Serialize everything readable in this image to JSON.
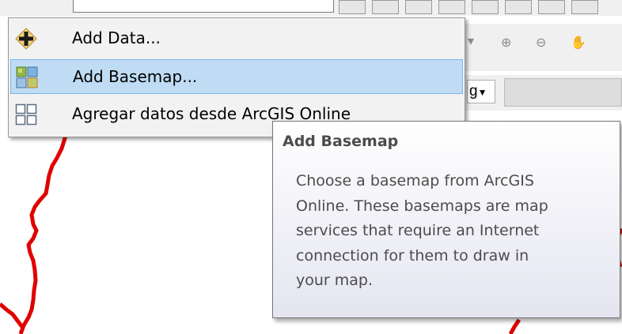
{
  "menu": {
    "items": [
      {
        "label": "Add Data...",
        "icon": "plus-diamond-icon",
        "highlighted": false
      },
      {
        "label": "Add Basemap...",
        "icon": "basemap-grid-icon",
        "highlighted": true
      },
      {
        "label": "Agregar datos desde ArcGIS Online",
        "icon": "grid-icon",
        "highlighted": false
      }
    ]
  },
  "toolbar": {
    "dropdown_value": "g"
  },
  "tooltip": {
    "title": "Add Basemap",
    "body_lines": [
      "Choose a basemap from ArcGIS",
      "Online. These basemaps are map",
      "services that require an Internet",
      "connection for them to draw in",
      "your map."
    ]
  },
  "colors": {
    "highlight_fill": "#bfdcf4",
    "highlight_border": "#7eb4ea",
    "map_line": "#e00000",
    "tooltip_text": "#4c4c4c"
  }
}
